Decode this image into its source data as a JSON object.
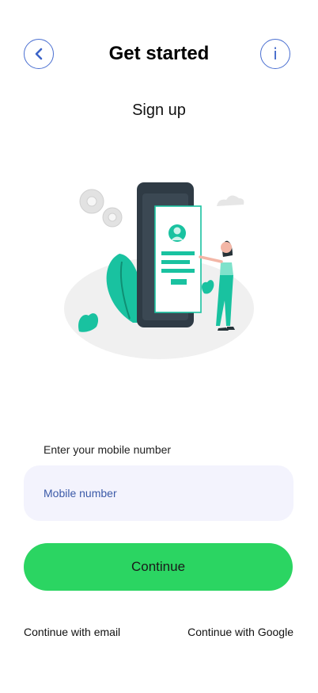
{
  "header": {
    "title": "Get started",
    "back_icon": "chevron-left-icon",
    "info_label": "i"
  },
  "subtitle": "Sign up",
  "illustration": {
    "name": "phone-signup-illustration",
    "colors": {
      "accent": "#19c2a0",
      "phone": "#2f3b45",
      "floor": "#f0f0f0",
      "gear": "#e6e6e6"
    }
  },
  "form": {
    "label": "Enter your mobile number",
    "mobile_placeholder": "Mobile number",
    "mobile_value": ""
  },
  "actions": {
    "continue_label": "Continue",
    "email_label": "Continue with email",
    "google_label": "Continue with Google"
  },
  "colors": {
    "primary": "#2bd562",
    "input_bg": "#f3f3fd",
    "link_blue": "#3c64c8"
  }
}
